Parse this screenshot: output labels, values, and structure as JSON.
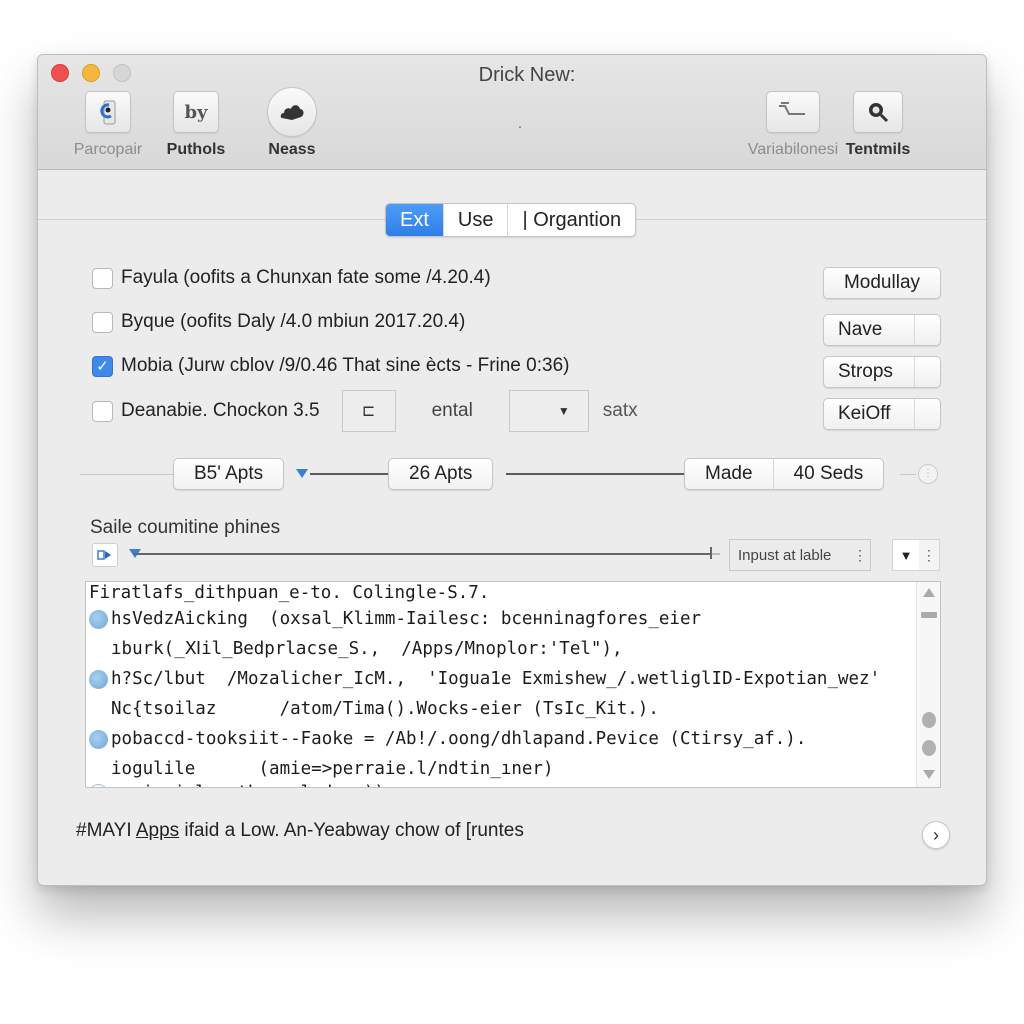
{
  "window": {
    "title": "Drick New:",
    "center_mark": "."
  },
  "toolbar": {
    "left": [
      {
        "label": "Parcopair",
        "icon": "user-badge-icon",
        "glyph": "",
        "dim": true
      },
      {
        "label": "Puthols",
        "icon": "text-style-icon",
        "glyph": "by",
        "dim": false
      },
      {
        "label": "Neass",
        "icon": "cloud-icon",
        "glyph": "☁",
        "dim": false
      }
    ],
    "right": [
      {
        "label": "Variabilonesi",
        "icon": "ticket-icon",
        "dim": true
      },
      {
        "label": "Tentmils",
        "icon": "magnifier-icon",
        "dim": false
      }
    ]
  },
  "tabs": [
    {
      "label": "Ext",
      "active": true
    },
    {
      "label": "Use",
      "active": false
    },
    {
      "label": "| Organtion",
      "active": false
    }
  ],
  "options": [
    {
      "label": "Fayula (oofits a  Chunxan fate some /4.20.4)",
      "checked": false
    },
    {
      "label": "Byque (oofits Daly /4.0 mbiun 2017.20.4)",
      "checked": false
    },
    {
      "label": "Mobia (Jurw cblov /9/0.46  That sine ècts - Frine 0:36)",
      "checked": true
    },
    {
      "label": "Deanabie. Chockon  3.5",
      "checked": false,
      "box_glyph": "⊏",
      "mid_label": "ental",
      "select_arrow": "▼",
      "end_label": "satx"
    }
  ],
  "side_buttons": [
    {
      "label": "Modullay"
    },
    {
      "label": "Nave"
    },
    {
      "label": "Strops"
    },
    {
      "label": "KeiOff"
    }
  ],
  "track": {
    "pill_1": "B5' Apts",
    "pill_2": "26 Apts",
    "pill_3a": "Made",
    "pill_3b": "40 Seds",
    "end_glyph": "⋮"
  },
  "section": {
    "title": "Saile coumitine phines",
    "field_label": "Inpust at lable",
    "field_dots": "⋮",
    "mini_arrow": "▼",
    "mini_dots": "⋮"
  },
  "code_lines": [
    {
      "text": "Firatlafs_dithpuan_e-to. Colingle-S.7.",
      "bullet": false,
      "indent": false
    },
    {
      "text": "hsVedzAicking  (oxsal_Klimm-Iailesc: bceнninagfores_eier",
      "bullet": true,
      "indent": false
    },
    {
      "text": "ıburk(_Ⅺil_Bedprlacse_S.,  /Apps/Mnoplor:'Tel\"),",
      "bullet": false,
      "indent": true
    },
    {
      "text": "h?Sc/lbut  /Mozalicher_IcM.,  'Iogua1e Exmishew_/.wetliglID-Expotian_wez'",
      "bullet": true,
      "indent": false
    },
    {
      "text": "Nc{tsoilaz      /atom/Tima().Wocks-eier (TsIc_Kit.).",
      "bullet": false,
      "indent": true
    },
    {
      "text": "pobaccd-tooksiit--Faoke = /Ab!/.oong/dhlapand.Pevice (Ctirsy_af.).",
      "bullet": true,
      "indent": false
    },
    {
      "text": "iogulile      (amie=>perraie.l/ndtin_ıner)",
      "bullet": false,
      "indent": true
    },
    {
      "text": "navivcial - ther-cl dera))",
      "bullet": true,
      "indent": false
    }
  ],
  "footer": {
    "prefix": "#MAYI ",
    "link": "Apps",
    "rest": " ifaid a Low. An-Yeabway chow of [runtes",
    "next_glyph": "›"
  }
}
